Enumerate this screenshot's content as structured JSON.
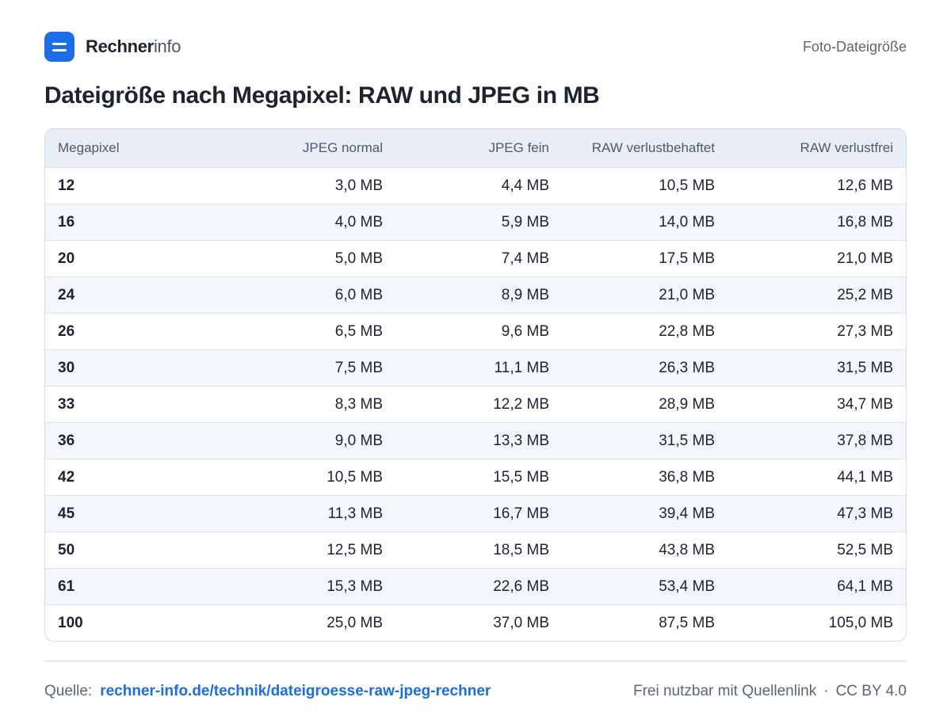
{
  "header": {
    "brand_bold": "Rechner",
    "brand_light": "info",
    "topic": "Foto-Dateigröße"
  },
  "title": "Dateigröße nach Megapixel: RAW und JPEG in MB",
  "table": {
    "columns": [
      "Megapixel",
      "JPEG normal",
      "JPEG fein",
      "RAW verlustbehaftet",
      "RAW verlustfrei"
    ],
    "rows": [
      [
        "12",
        "3,0 MB",
        "4,4 MB",
        "10,5 MB",
        "12,6 MB"
      ],
      [
        "16",
        "4,0 MB",
        "5,9 MB",
        "14,0 MB",
        "16,8 MB"
      ],
      [
        "20",
        "5,0 MB",
        "7,4 MB",
        "17,5 MB",
        "21,0 MB"
      ],
      [
        "24",
        "6,0 MB",
        "8,9 MB",
        "21,0 MB",
        "25,2 MB"
      ],
      [
        "26",
        "6,5 MB",
        "9,6 MB",
        "22,8 MB",
        "27,3 MB"
      ],
      [
        "30",
        "7,5 MB",
        "11,1 MB",
        "26,3 MB",
        "31,5 MB"
      ],
      [
        "33",
        "8,3 MB",
        "12,2 MB",
        "28,9 MB",
        "34,7 MB"
      ],
      [
        "36",
        "9,0 MB",
        "13,3 MB",
        "31,5 MB",
        "37,8 MB"
      ],
      [
        "42",
        "10,5 MB",
        "15,5 MB",
        "36,8 MB",
        "44,1 MB"
      ],
      [
        "45",
        "11,3 MB",
        "16,7 MB",
        "39,4 MB",
        "47,3 MB"
      ],
      [
        "50",
        "12,5 MB",
        "18,5 MB",
        "43,8 MB",
        "52,5 MB"
      ],
      [
        "61",
        "15,3 MB",
        "22,6 MB",
        "53,4 MB",
        "64,1 MB"
      ],
      [
        "100",
        "25,0 MB",
        "37,0 MB",
        "87,5 MB",
        "105,0 MB"
      ]
    ]
  },
  "footer": {
    "source_label": "Quelle:",
    "source_link": "rechner-info.de/technik/dateigroesse-raw-jpeg-rechner",
    "license_text": "Frei nutzbar mit Quellenlink",
    "separator": "·",
    "license": "CC BY 4.0"
  },
  "colors": {
    "accent": "#1a6ee6",
    "header_bg": "#e9eef6",
    "stripe_bg": "#f3f6fb",
    "text": "#1c2434"
  },
  "icons": {
    "logo": "menu-lines-icon"
  }
}
